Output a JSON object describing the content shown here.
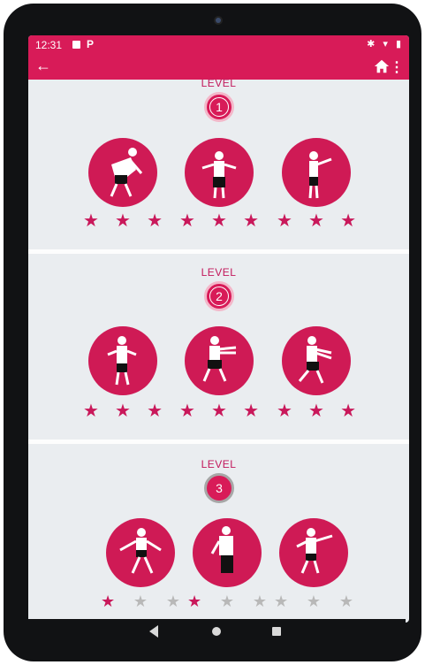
{
  "statusbar": {
    "time": "12:31",
    "notif_p": "P",
    "sys_icons": "✱ ▾ ▮"
  },
  "toolbar": {
    "back_glyph": "←",
    "more_glyph": "⋮"
  },
  "colors": {
    "accent": "#d81b58",
    "background": "#eaedf0",
    "star_on": "#c9185a",
    "star_off": "#b8b8b8"
  },
  "levels": [
    {
      "label": "LEVEL",
      "number": "1",
      "state": "active",
      "exercises": [
        {
          "stars": 3
        },
        {
          "stars": 3
        },
        {
          "stars": 3
        }
      ]
    },
    {
      "label": "LEVEL",
      "number": "2",
      "state": "active",
      "exercises": [
        {
          "stars": 3
        },
        {
          "stars": 3
        },
        {
          "stars": 3
        }
      ]
    },
    {
      "label": "LEVEL",
      "number": "3",
      "state": "locked",
      "exercises": [
        {
          "stars": 1
        },
        {
          "stars": 1
        },
        {
          "stars": 0
        }
      ]
    }
  ],
  "star_glyph": "★"
}
